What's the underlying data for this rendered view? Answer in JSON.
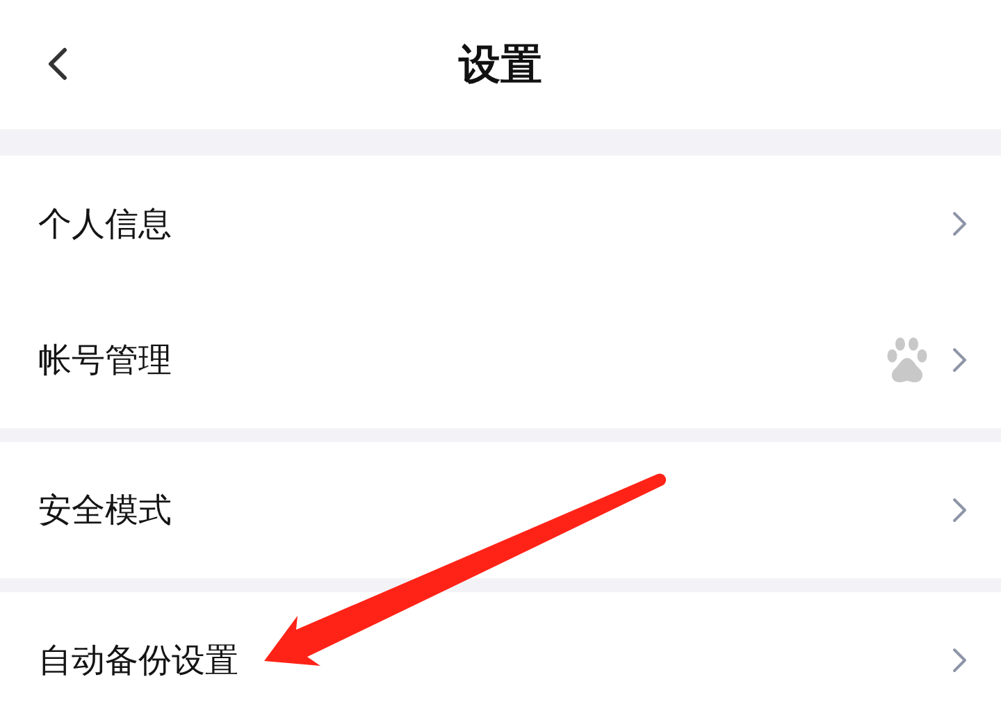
{
  "header": {
    "title": "设置"
  },
  "groups": [
    {
      "items": [
        {
          "label": "个人信息",
          "kind": "plain"
        },
        {
          "label": "帐号管理",
          "kind": "account"
        }
      ]
    },
    {
      "items": [
        {
          "label": "安全模式",
          "kind": "plain"
        }
      ]
    },
    {
      "items": [
        {
          "label": "自动备份设置",
          "kind": "plain"
        }
      ]
    }
  ],
  "annotation": {
    "kind": "arrow"
  }
}
